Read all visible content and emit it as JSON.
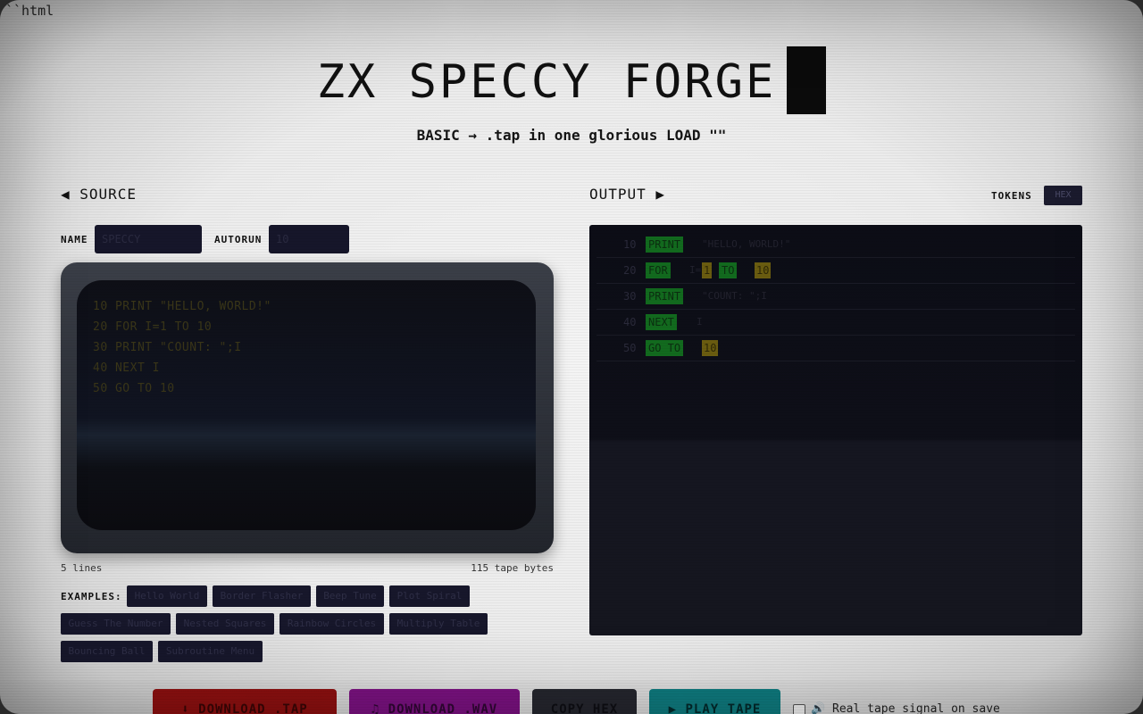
{
  "stray_text": "``html",
  "header": {
    "title": "ZX SPECCY FORGE",
    "subtitle": "BASIC → .tap in one glorious LOAD \"\""
  },
  "source": {
    "label": "◀ SOURCE",
    "name_label": "NAME",
    "name_value": "SPECCY",
    "autorun_label": "AUTORUN",
    "autorun_value": "10",
    "code_lines": [
      "10 PRINT \"HELLO, WORLD!\"",
      "20 FOR I=1 TO 10",
      "30 PRINT \"COUNT: \";I",
      "40 NEXT I",
      "50 GO TO 10"
    ],
    "lines_count": "5 lines",
    "tape_bytes": "115 tape bytes"
  },
  "examples": {
    "label": "EXAMPLES:",
    "items": [
      "Hello World",
      "Border Flasher",
      "Beep Tune",
      "Plot Spiral",
      "Guess The Number",
      "Nested Squares",
      "Rainbow Circles",
      "Multiply Table",
      "Bouncing Ball",
      "Subroutine Menu"
    ]
  },
  "output": {
    "label": "OUTPUT ▶",
    "tokens_label": "TOKENS",
    "hex_label": "HEX",
    "rows": [
      {
        "num": "10",
        "kw": "PRINT",
        "rest": "\"HELLO, WORLD!\""
      },
      {
        "num": "20",
        "kw": "FOR",
        "rest": "I=",
        "n1": "1",
        "kw2": "TO",
        "n2": "10"
      },
      {
        "num": "30",
        "kw": "PRINT",
        "rest": "\"COUNT: \";I"
      },
      {
        "num": "40",
        "kw": "NEXT",
        "rest": "I"
      },
      {
        "num": "50",
        "kw": "GO TO",
        "n1": "10"
      }
    ]
  },
  "actions": {
    "download_tap": "⬇ DOWNLOAD .TAP",
    "download_wav": "♫ DOWNLOAD .WAV",
    "copy_hex": "COPY HEX",
    "play_tape": "▶ PLAY TAPE",
    "real_signal_label": "🔊 Real tape signal on save"
  },
  "colors": {
    "download_tap": "#8e1010",
    "download_wav": "#7c1282",
    "copy_hex": "#26272f",
    "play_tape": "#0f7c80",
    "keyword": "#126a1e",
    "number": "#6a5c10"
  }
}
